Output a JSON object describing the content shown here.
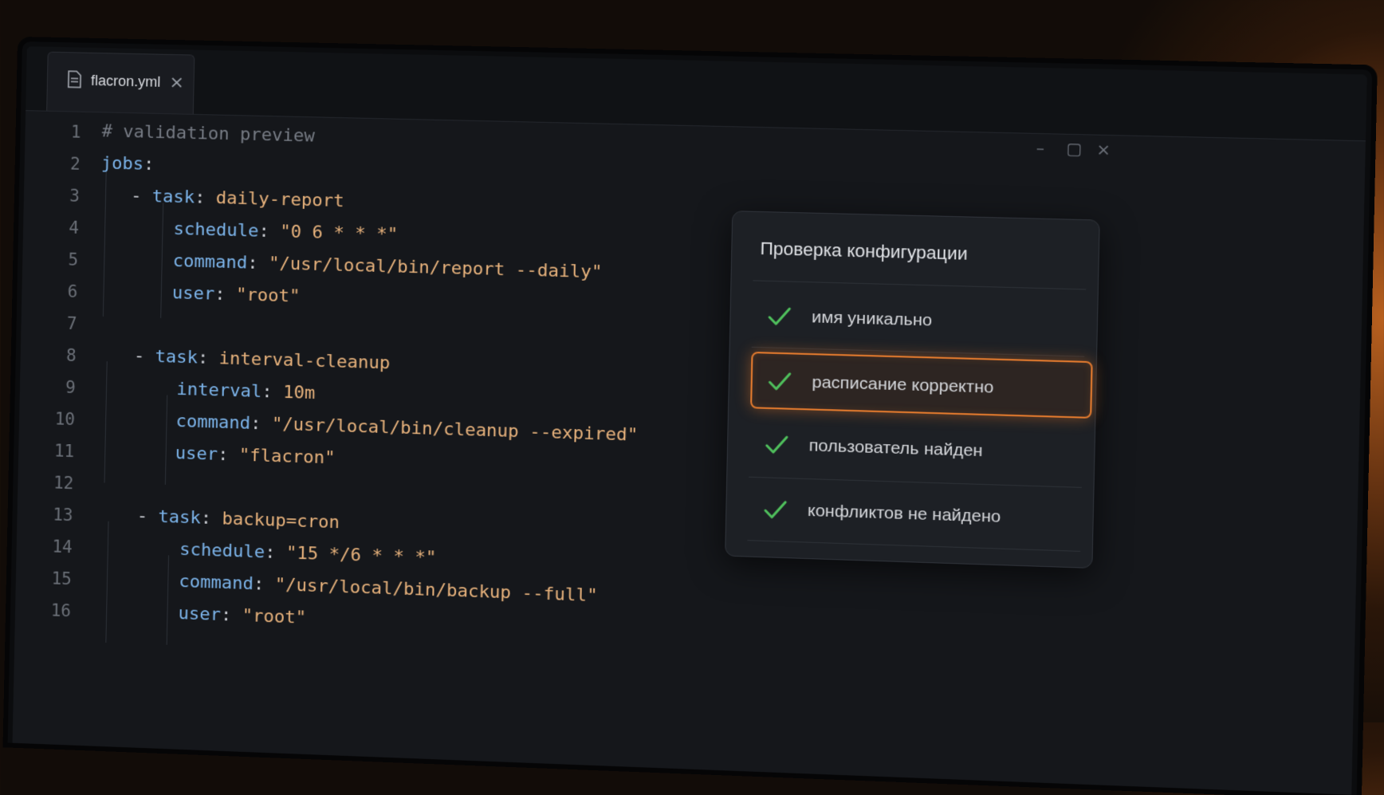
{
  "tab": {
    "filename": "flacron.yml",
    "close_glyph": "×",
    "file_icon": "file-icon"
  },
  "window_controls": {
    "minimize": "–",
    "maximize": "▢",
    "close": "×"
  },
  "line_numbers": [
    "1",
    "2",
    "3",
    "4",
    "5",
    "6",
    "7",
    "8",
    "9",
    "10",
    "11",
    "12",
    "13",
    "14",
    "15",
    "16"
  ],
  "code": {
    "comment": "# validation preview",
    "jobs_key": "jobs",
    "tasks": [
      {
        "task": "daily-report",
        "fields": [
          {
            "key": "schedule",
            "value": "\"0 6 * * *\""
          },
          {
            "key": "command",
            "value": "\"/usr/local/bin/report --daily\""
          },
          {
            "key": "user",
            "value": "\"root\""
          }
        ]
      },
      {
        "task": "interval-cleanup",
        "fields": [
          {
            "key": "interval",
            "value": "10m"
          },
          {
            "key": "command",
            "value": "\"/usr/local/bin/cleanup --expired\""
          },
          {
            "key": "user",
            "value": "\"flacron\""
          }
        ]
      },
      {
        "task": "backup=cron",
        "fields": [
          {
            "key": "schedule",
            "value": "\"15 */6 * * *\""
          },
          {
            "key": "command",
            "value": "\"/usr/local/bin/backup --full\""
          },
          {
            "key": "user",
            "value": "\"root\""
          }
        ]
      }
    ]
  },
  "validation": {
    "title": "Проверка конфигурации",
    "checks": [
      {
        "label": "имя уникально",
        "status": "ok",
        "active": false
      },
      {
        "label": "расписание корректно",
        "status": "ok",
        "active": true
      },
      {
        "label": "пользователь найден",
        "status": "ok",
        "active": false
      },
      {
        "label": "конфликтов не найдено",
        "status": "ok",
        "active": false
      }
    ]
  },
  "colors": {
    "accent": "#e27a2e",
    "check": "#4fbf5c",
    "key": "#7cb4ea",
    "value": "#e7b27c"
  }
}
